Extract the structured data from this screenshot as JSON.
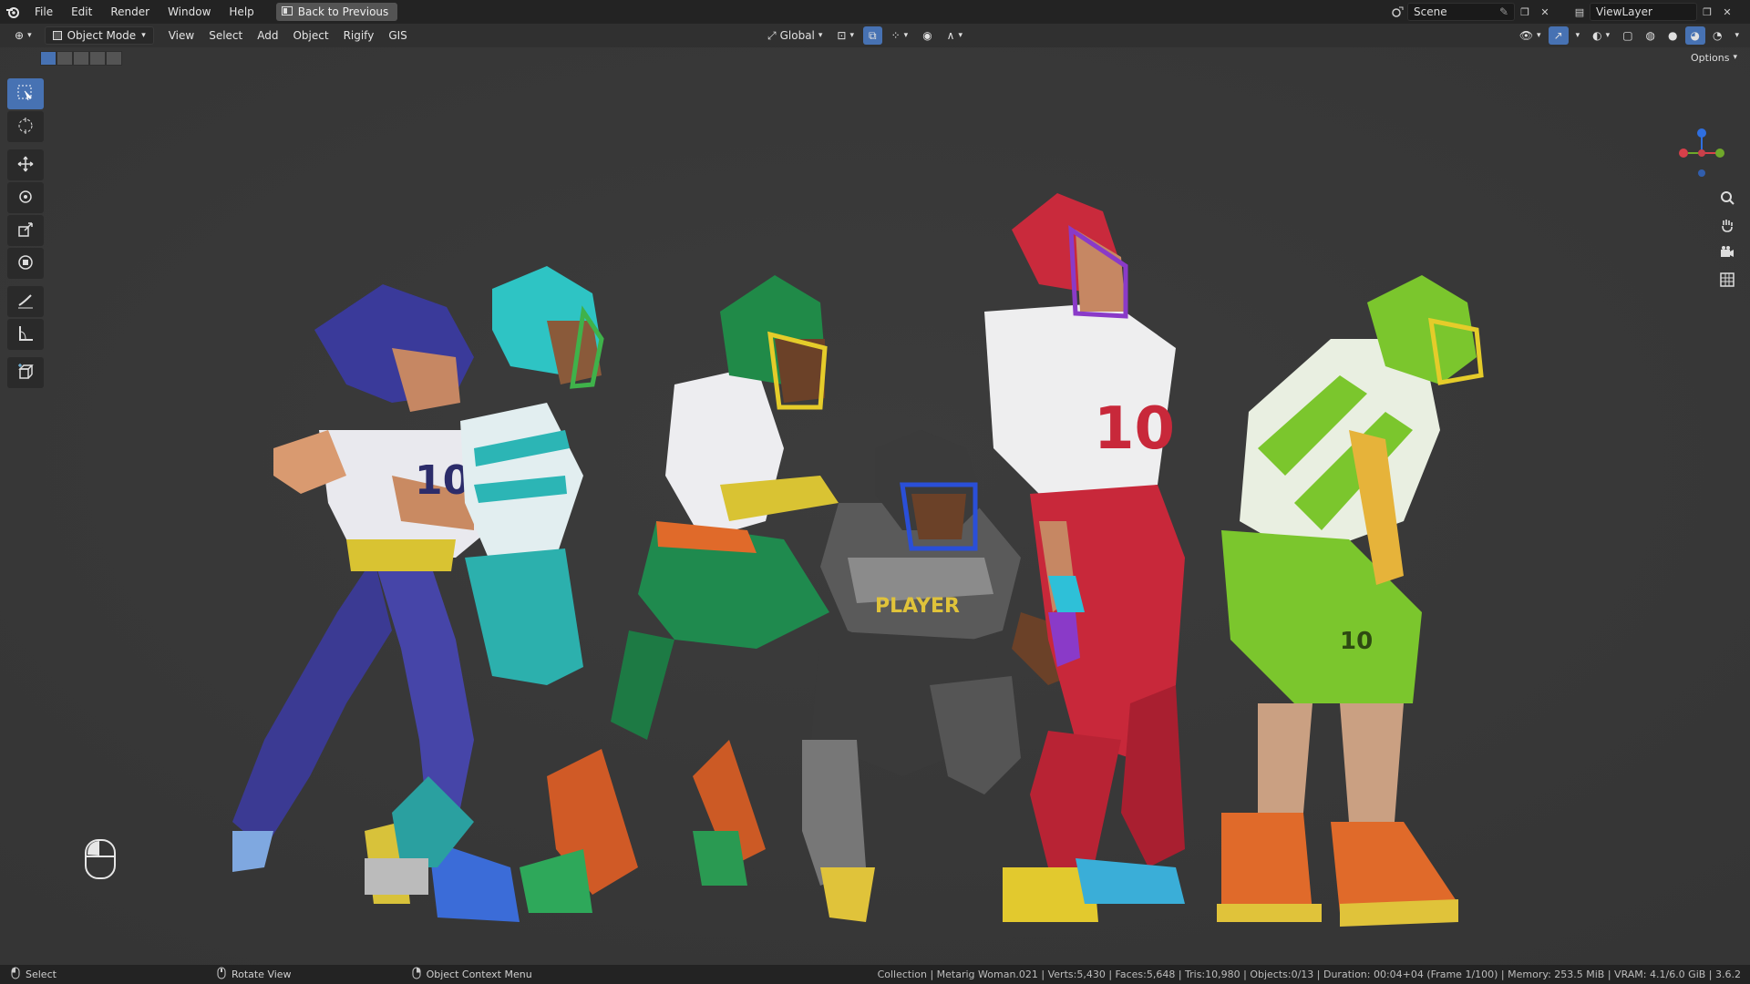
{
  "topbar": {
    "menus": [
      "File",
      "Edit",
      "Render",
      "Window",
      "Help"
    ],
    "back_button": "Back to Previous",
    "scene_name": "Scene",
    "view_layer": "ViewLayer"
  },
  "viewport_header": {
    "mode": "Object Mode",
    "menus": [
      "View",
      "Select",
      "Add",
      "Object",
      "Rigify",
      "GIS"
    ],
    "orientation": "Global"
  },
  "viewport": {
    "options_label": "Options",
    "figures": [
      {
        "name": "purple-player",
        "primary": "#3f3f9e",
        "jersey": "#e8e8ec",
        "accent": "#e0c33a"
      },
      {
        "name": "teal-player",
        "primary": "#2bb7b4",
        "jersey": "#e8e8ec",
        "accent": "#3aa04a"
      },
      {
        "name": "green-player",
        "primary": "#1f8f4e",
        "jersey": "#e8e8ec",
        "accent": "#e06a2a"
      },
      {
        "name": "black-player",
        "primary": "#3b3b3b",
        "jersey": "#8a8a8a",
        "accent": "#e0c33a"
      },
      {
        "name": "red-player",
        "primary": "#c8283a",
        "jersey": "#ececec",
        "accent": "#3aaed8"
      },
      {
        "name": "lime-player",
        "primary": "#7bc62d",
        "jersey": "#e8e8ec",
        "accent": "#e06a2a"
      }
    ]
  },
  "tools": [
    "select-box",
    "cursor",
    "move",
    "rotate",
    "scale",
    "transform",
    "annotate",
    "measure",
    "add-cube"
  ],
  "statusbar": {
    "select": "Select",
    "rotate": "Rotate View",
    "context": "Object Context Menu",
    "stats": "Collection | Metarig Woman.021 | Verts:5,430 | Faces:5,648 | Tris:10,980 | Objects:0/13 | Duration: 00:04+04 (Frame 1/100) | Memory: 253.5 MiB | VRAM: 4.1/6.0 GiB | 3.6.2"
  },
  "colors": {
    "accent": "#4772b3",
    "viewport_bg": "#393939"
  }
}
